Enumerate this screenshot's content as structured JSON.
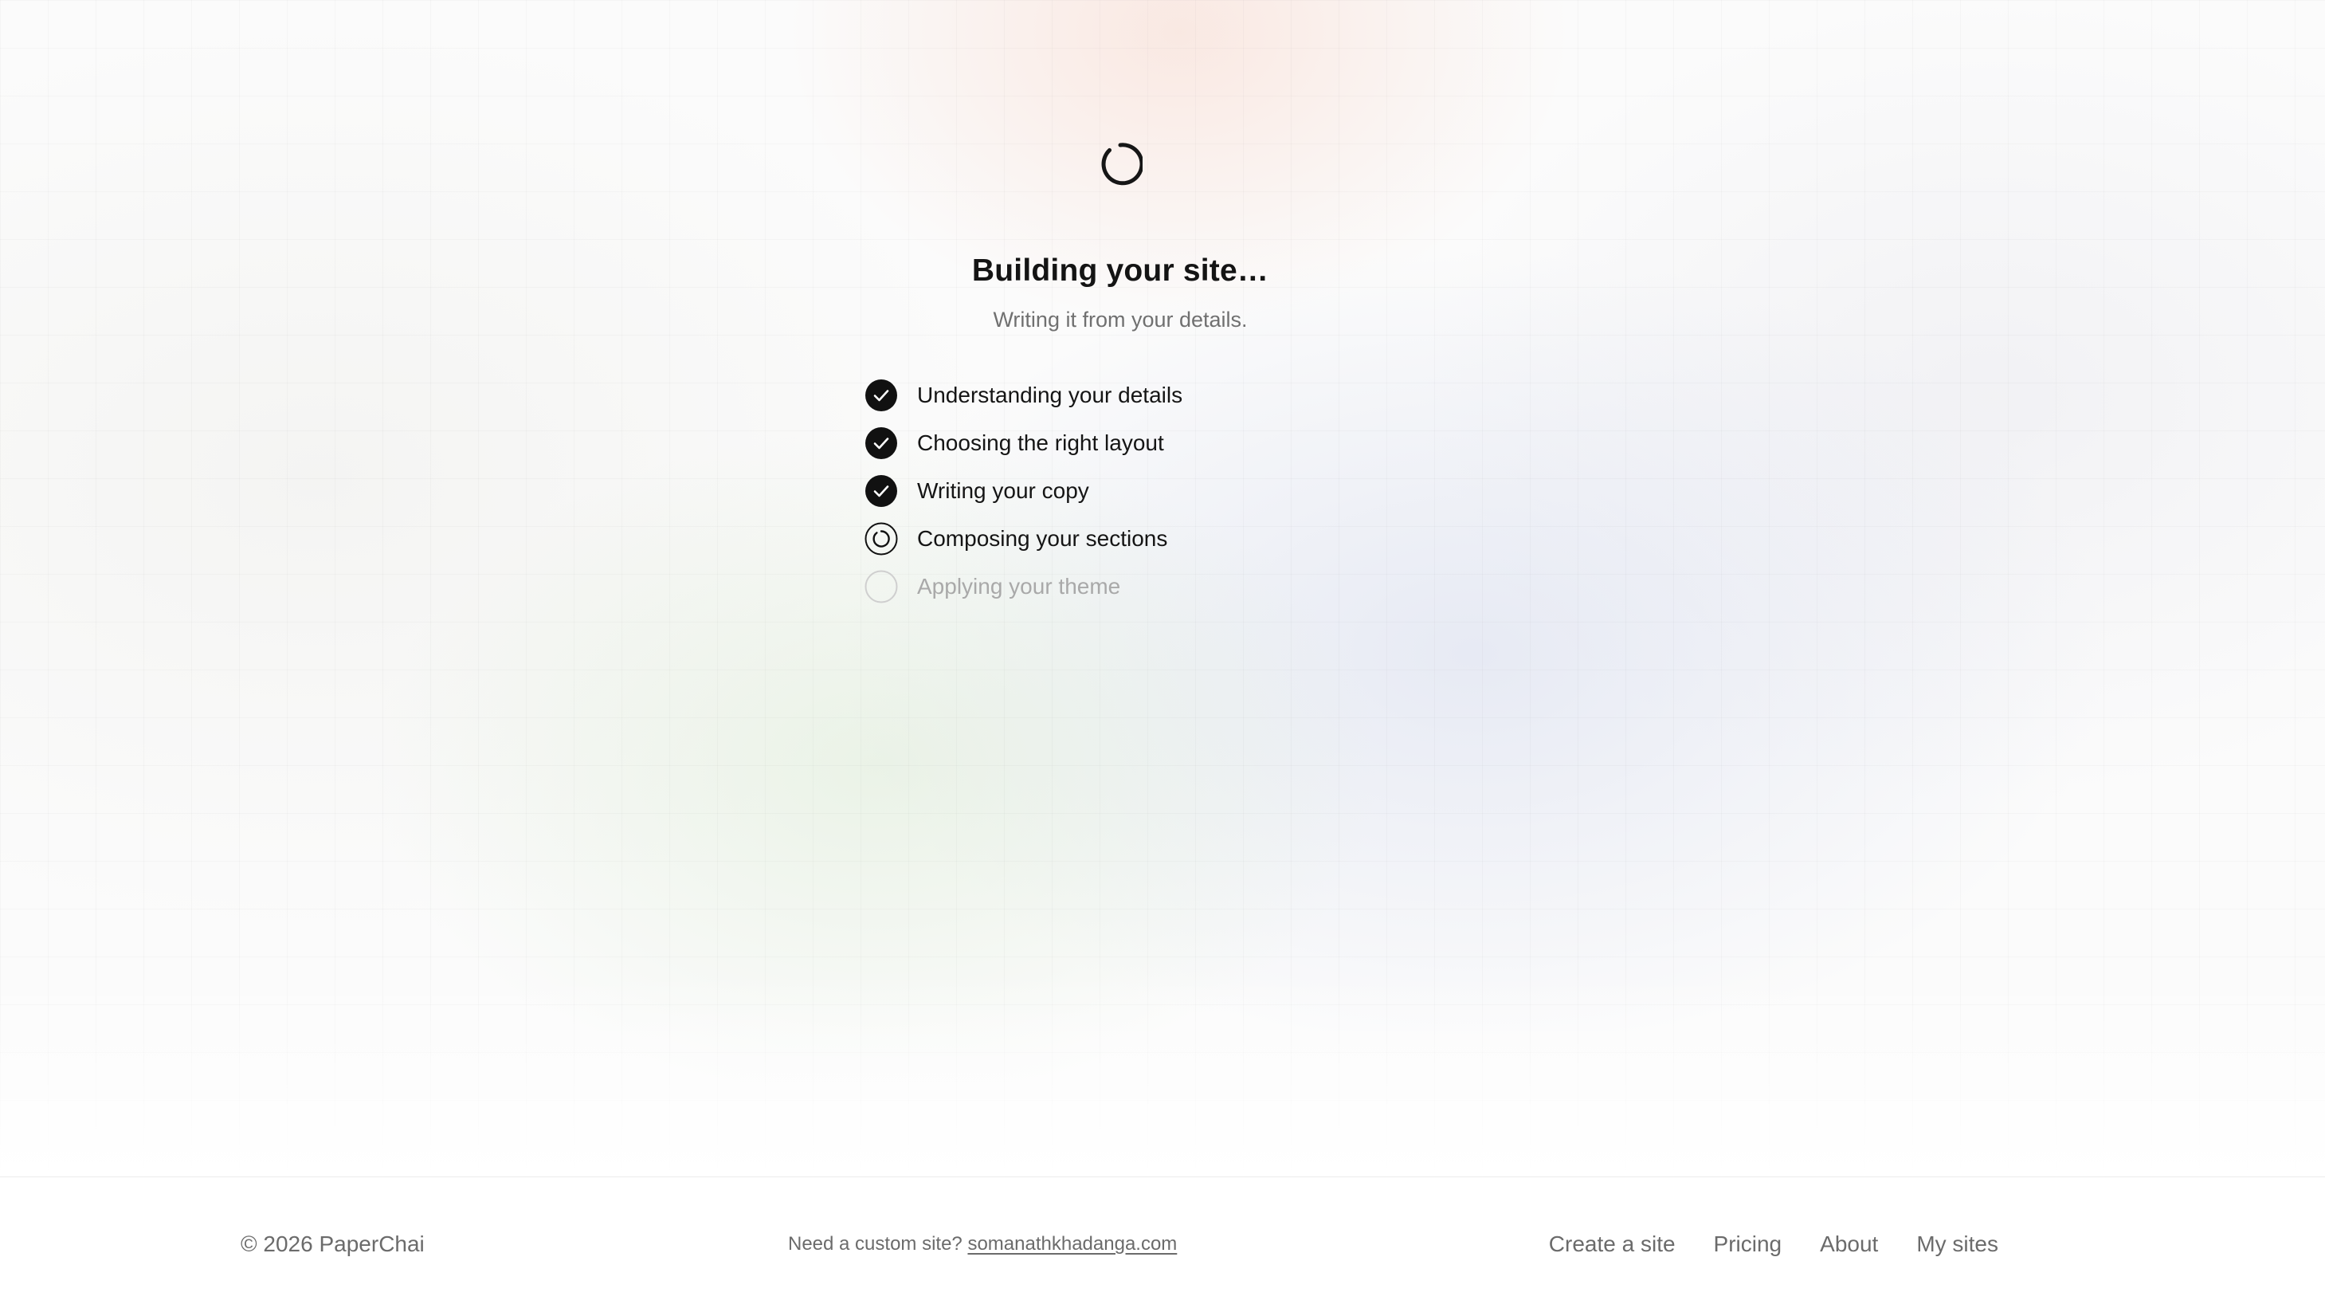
{
  "main": {
    "title": "Building your site…",
    "subtitle": "Writing it from your details.",
    "steps": [
      {
        "label": "Understanding your details",
        "status": "done"
      },
      {
        "label": "Choosing the right layout",
        "status": "done"
      },
      {
        "label": "Writing your copy",
        "status": "done"
      },
      {
        "label": "Composing your sections",
        "status": "in-progress"
      },
      {
        "label": "Applying your theme",
        "status": "pending"
      }
    ]
  },
  "footer": {
    "copyright": "© 2026 PaperChai",
    "custom_prefix": "Need a custom site?",
    "custom_link": "somanathkhadanga.com",
    "nav": [
      "Create a site",
      "Pricing",
      "About",
      "My sites"
    ]
  },
  "icons": {
    "spinner": "loading-spinner-icon",
    "done": "check-circle-icon",
    "in_progress": "progress-circle-icon",
    "pending": "empty-circle-icon"
  },
  "colors": {
    "text": "#141414",
    "muted": "#707070",
    "pending": "#a9a9a9",
    "accent": "#111111"
  }
}
